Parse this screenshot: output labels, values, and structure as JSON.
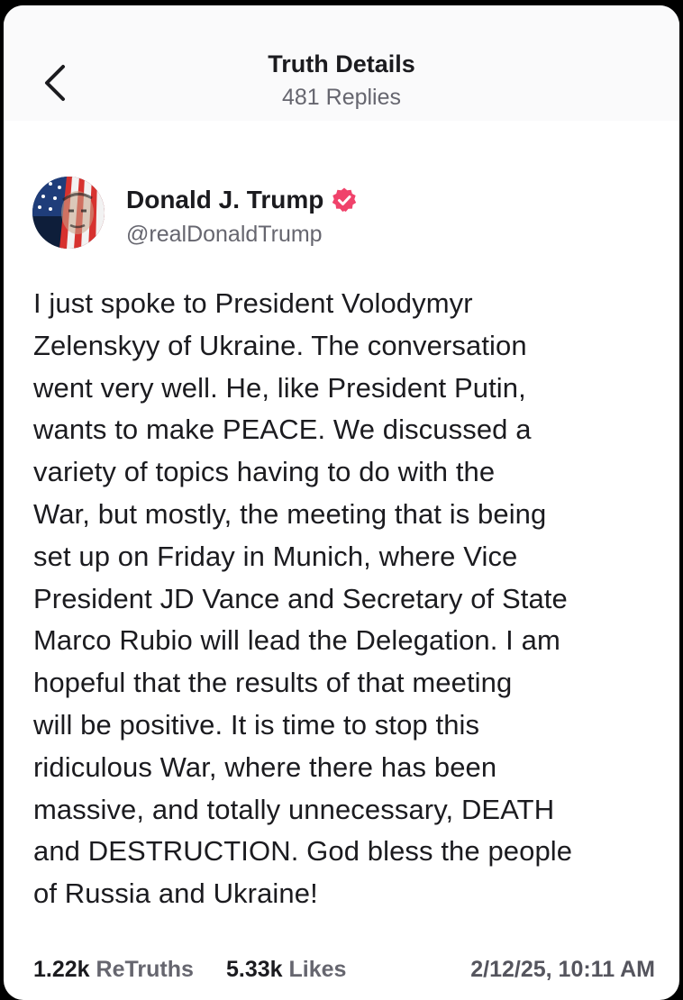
{
  "header": {
    "title": "Truth Details",
    "subtitle": "481 Replies",
    "back_icon": "chevron-left-icon"
  },
  "author": {
    "display_name": "Donald J. Trump",
    "handle": "@realDonaldTrump",
    "verified_icon": "verified-badge-icon",
    "verified_color": "#f0426b"
  },
  "post": {
    "lines": [
      "I just spoke to President Volodymyr",
      "Zelenskyy of Ukraine. The conversation",
      "went very well. He, like President Putin,",
      "wants to make PEACE. We discussed a",
      "variety of topics having to do with the",
      "War, but mostly, the meeting that is being",
      "set up on Friday in Munich, where Vice",
      "President JD Vance and Secretary of State",
      "Marco Rubio will lead the Delegation. I am",
      "hopeful that the results of that meeting",
      "will be positive. It is time to stop this",
      "ridiculous War, where there has been",
      "massive, and totally unnecessary, DEATH",
      "and DESTRUCTION. God bless the people",
      "of Russia and Ukraine!"
    ]
  },
  "stats": {
    "retruths_count": "1.22k",
    "retruths_label": "ReTruths",
    "likes_count": "5.33k",
    "likes_label": "Likes",
    "timestamp": "2/12/25, 10:11 AM"
  }
}
